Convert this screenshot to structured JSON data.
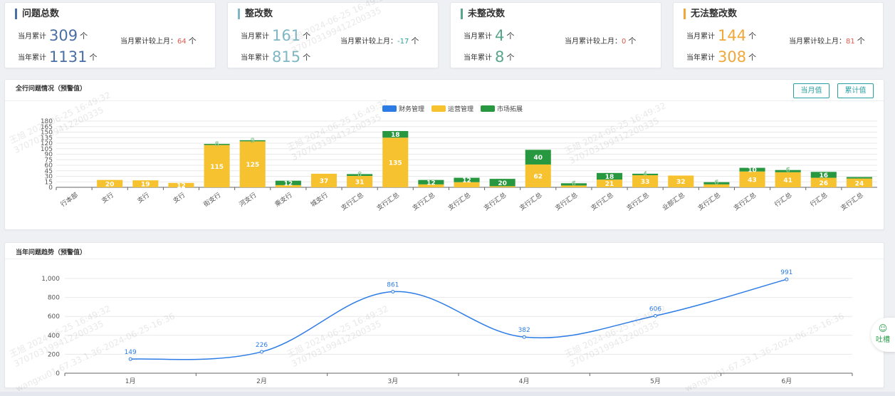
{
  "kpis": [
    {
      "title": "问题总数",
      "accent": "#4a6fa5",
      "num_color": "#4a6fa5",
      "month_label": "当月累计",
      "month_value": "309",
      "unit": "个",
      "year_label": "当年累计",
      "year_value": "1131",
      "cmp_label": "当月累计较上月：",
      "cmp_value": "64",
      "cmp_color": "#e05a4f",
      "cmp_unit": "个"
    },
    {
      "title": "整改数",
      "accent": "#7fb8c4",
      "num_color": "#7fb8c4",
      "month_label": "当月累计",
      "month_value": "161",
      "unit": "个",
      "year_label": "当年累计",
      "year_value": "815",
      "cmp_label": "当月累计较上月：",
      "cmp_value": "-17",
      "cmp_color": "#2aa198",
      "cmp_unit": "个"
    },
    {
      "title": "未整改数",
      "accent": "#58a58a",
      "num_color": "#58a58a",
      "month_label": "当月累计",
      "month_value": "4",
      "unit": "个",
      "year_label": "当年累计",
      "year_value": "8",
      "cmp_label": "当月累计较上月：",
      "cmp_value": "0",
      "cmp_color": "#e05a4f",
      "cmp_unit": "个"
    },
    {
      "title": "无法整改数",
      "accent": "#f0a83a",
      "num_color": "#f0a83a",
      "month_label": "当月累计",
      "month_value": "144",
      "unit": "个",
      "year_label": "当年累计",
      "year_value": "308",
      "cmp_label": "当月累计较上月：",
      "cmp_value": "81",
      "cmp_color": "#e05a4f",
      "cmp_unit": "个"
    }
  ],
  "bank_panel": {
    "title": "全行问题情况（预警值）",
    "btn_month": "当月值",
    "btn_total": "累计值"
  },
  "trend_panel": {
    "title": "当年问题趋势（预警值）"
  },
  "chat": {
    "label": "吐槽"
  },
  "watermark": {
    "lines": [
      "王旭 2024-06-25 16:49:32",
      "370703199412200335",
      "wangxu01-67.33.1.36-2024-06-25-16:36"
    ]
  },
  "chart_data": [
    {
      "type": "bar",
      "stacked": true,
      "title": "全行问题情况（预警值）",
      "ylim": [
        0,
        180
      ],
      "yticks": [
        0,
        15,
        30,
        45,
        60,
        75,
        90,
        105,
        120,
        135,
        150,
        165,
        180
      ],
      "grid": true,
      "legend_position": "top-center",
      "categories": [
        "行本部",
        "支行",
        "支行",
        "支行",
        "街支行",
        "河支行",
        "乘支行",
        "城支行",
        "支行汇总",
        "支行汇总",
        "支行汇总",
        "支行汇总",
        "支行汇总",
        "支行汇总",
        "支行汇总",
        "支行汇总",
        "支行汇总",
        "业部汇总",
        "支行汇总",
        "支行汇总",
        "行汇总",
        "行汇总",
        "支行汇总"
      ],
      "series": [
        {
          "name": "财务管理",
          "color": "#2d7ce6",
          "values": [
            0,
            0,
            0,
            0,
            0,
            0,
            0,
            0,
            0,
            0,
            0,
            0,
            0,
            0,
            0,
            0,
            0,
            0,
            0,
            0,
            0,
            0,
            0
          ],
          "labels": [
            "",
            "",
            "",
            "",
            "",
            "",
            "",
            "",
            "",
            "",
            "",
            "",
            "",
            "",
            "",
            "",
            "",
            "",
            "",
            "",
            "",
            "",
            ""
          ]
        },
        {
          "name": "运营管理",
          "color": "#f7c22f",
          "values": [
            0,
            20,
            19,
            12,
            115,
            125,
            6,
            37,
            31,
            135,
            8,
            14,
            3,
            62,
            5,
            21,
            33,
            32,
            8,
            43,
            41,
            26,
            24
          ],
          "labels": [
            "",
            "20",
            "19",
            "12",
            "115",
            "125",
            "",
            "37",
            "31",
            "135",
            "",
            "",
            "",
            "62",
            "",
            "21",
            "33",
            "32",
            "",
            "43",
            "41",
            "26",
            "24"
          ]
        },
        {
          "name": "市场拓展",
          "color": "#27983f",
          "values": [
            0,
            0,
            0,
            0,
            3,
            3,
            12,
            0,
            5,
            18,
            12,
            12,
            20,
            40,
            6,
            18,
            4,
            0,
            6,
            10,
            6,
            16,
            4
          ],
          "labels": [
            "",
            "",
            "",
            "",
            "",
            "",
            "12",
            "",
            "",
            "18",
            "12",
            "12",
            "20",
            "40",
            "",
            "18",
            "",
            "",
            "",
            "10",
            "",
            "16",
            ""
          ]
        }
      ],
      "overlay_labels": [
        "",
        "",
        "",
        "",
        "8",
        "9",
        "",
        "",
        "8",
        "",
        "",
        "",
        "",
        "",
        "6",
        "",
        "4",
        "",
        "6",
        "",
        "6",
        "",
        ""
      ]
    },
    {
      "type": "line",
      "title": "当年问题趋势（预警值）",
      "categories": [
        "1月",
        "2月",
        "3月",
        "4月",
        "5月",
        "6月"
      ],
      "ylim": [
        0,
        1000
      ],
      "yticks": [
        0,
        200,
        400,
        600,
        800,
        1000
      ],
      "ytick_labels": [
        "0",
        "200",
        "400",
        "600",
        "800",
        "1,000"
      ],
      "grid": true,
      "series": [
        {
          "color": "#2d7ce6",
          "values": [
            149,
            226,
            861,
            382,
            606,
            991
          ]
        }
      ]
    }
  ]
}
